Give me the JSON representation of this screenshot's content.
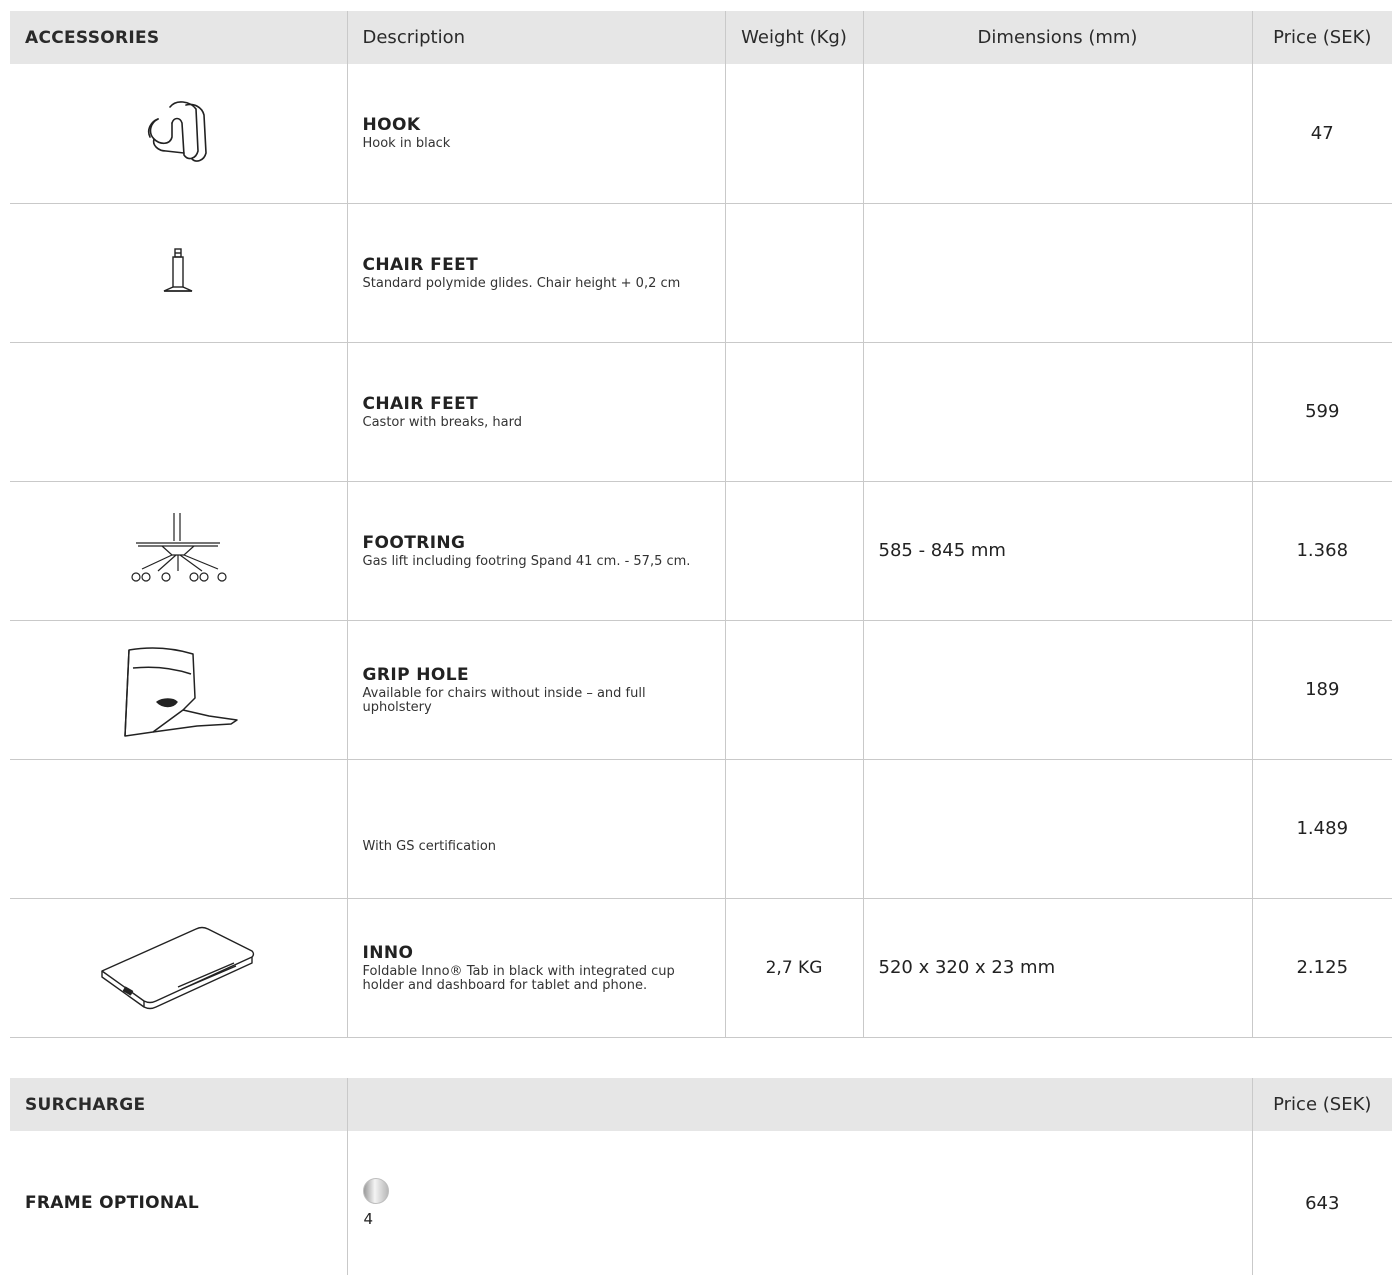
{
  "accessories": {
    "headers": {
      "col1": "ACCESSORIES",
      "col2": "Description",
      "col3": "Weight (Kg)",
      "col4": "Dimensions (mm)",
      "col5": "Price (SEK)"
    },
    "rows": [
      {
        "icon": "hook-icon",
        "title": "HOOK",
        "text": "Hook in black",
        "weight": "",
        "dimensions": "",
        "price": "47"
      },
      {
        "icon": "glide-icon",
        "title": "CHAIR FEET",
        "text": "Standard polymide glides. Chair height + 0,2 cm",
        "weight": "",
        "dimensions": "",
        "price": ""
      },
      {
        "icon": "",
        "title": "CHAIR FEET",
        "text": "Castor with breaks, hard",
        "weight": "",
        "dimensions": "",
        "price": "599"
      },
      {
        "icon": "footring-base-icon",
        "title": "FOOTRING",
        "text": "Gas lift including footring Spand 41 cm. - 57,5 cm.",
        "weight": "",
        "dimensions": "585 - 845 mm",
        "price": "1.368"
      },
      {
        "icon": "chair-shell-icon",
        "title": "GRIP HOLE",
        "text": "Available for chairs without inside – and full upholstery",
        "weight": "",
        "dimensions": "",
        "price": "189"
      },
      {
        "icon": "",
        "title": "",
        "text": "With GS certification",
        "weight": "",
        "dimensions": "",
        "price": "1.489"
      },
      {
        "icon": "tablet-tray-icon",
        "title": "INNO",
        "text": "Foldable Inno® Tab in black with integrated cup holder and dashboard for tablet and phone.",
        "weight": "2,7 KG",
        "dimensions": "520 x 320 x 23 mm",
        "price": "2.125"
      }
    ]
  },
  "surcharge": {
    "headers": {
      "col1": "SURCHARGE",
      "col2": "",
      "col3": "Price (SEK)"
    },
    "rows": [
      {
        "label": "FRAME OPTIONAL",
        "swatch_icon": "chrome-swatch-icon",
        "swatch_label": "4",
        "price": "643"
      }
    ]
  },
  "colors": {
    "header_bg": "#e6e6e6",
    "grid_line": "#c9c9c9",
    "text": "#222222"
  }
}
